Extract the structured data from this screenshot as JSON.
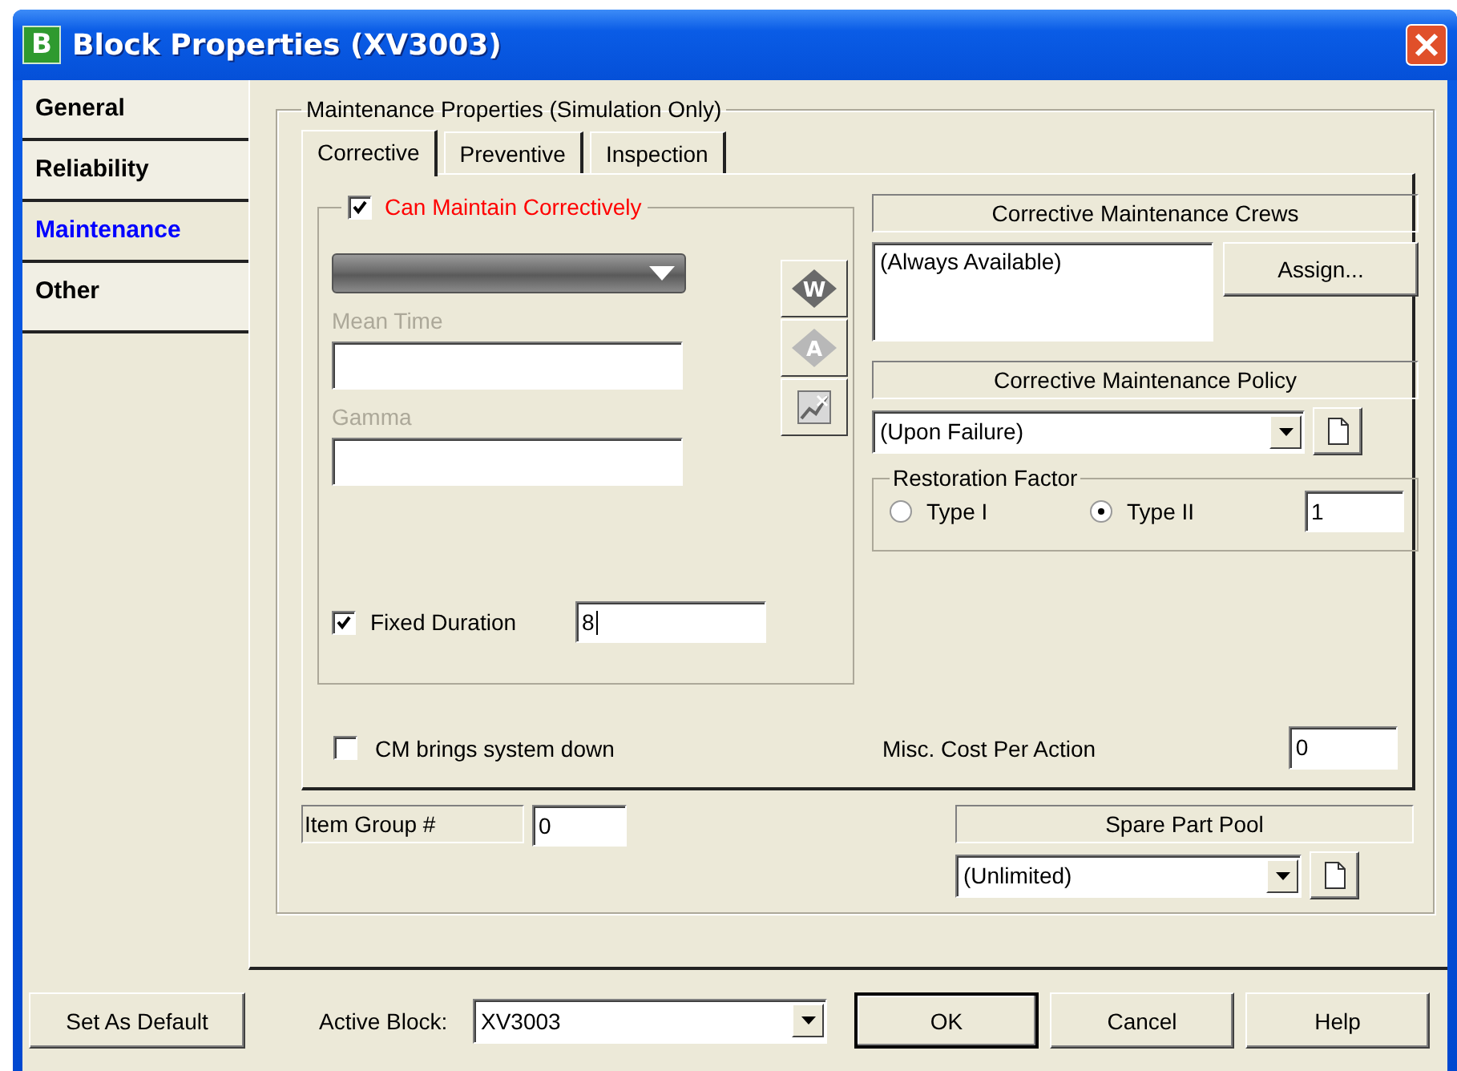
{
  "window": {
    "title": "Block Properties (XV3003)",
    "logo": "B"
  },
  "sidebar": {
    "items": [
      {
        "label": "General",
        "selected": false
      },
      {
        "label": "Reliability",
        "selected": false
      },
      {
        "label": "Maintenance",
        "selected": true
      },
      {
        "label": "Other",
        "selected": false
      }
    ]
  },
  "group_title": "Maintenance Properties (Simulation Only)",
  "tabs": [
    {
      "label": "Corrective",
      "selected": true
    },
    {
      "label": "Preventive",
      "selected": false
    },
    {
      "label": "Inspection",
      "selected": false
    }
  ],
  "corrective": {
    "can_maintain": {
      "label": "Can Maintain Correctively",
      "checked": true
    },
    "fields": [
      {
        "label": "Mean Time",
        "disabled": true
      },
      {
        "label": "Gamma",
        "disabled": true
      }
    ],
    "icon_buttons": [
      {
        "kind": "diamond",
        "label": "W",
        "disabled": false
      },
      {
        "kind": "diamond",
        "label": "A",
        "disabled": true
      },
      {
        "kind": "chart"
      }
    ],
    "fixed_duration": {
      "label": "Fixed Duration",
      "checked": true,
      "value": "8"
    },
    "crews": {
      "header": "Corrective Maintenance Crews",
      "items": [
        "(Always Available)"
      ],
      "button": "Assign..."
    },
    "policy": {
      "header": "Corrective Maintenance Policy",
      "value": "(Upon Failure)"
    },
    "restoration": {
      "title": "Restoration Factor",
      "options": [
        {
          "label": "Type I",
          "selected": false
        },
        {
          "label": "Type II",
          "selected": true
        }
      ],
      "value": "1"
    },
    "cm_down": {
      "label": "CM brings system down",
      "checked": false
    },
    "misc_cost": {
      "label": "Misc. Cost Per Action",
      "value": "0"
    }
  },
  "item_group": {
    "label": "Item Group #",
    "value": "0"
  },
  "spare_pool": {
    "header": "Spare Part Pool",
    "value": "(Unlimited)"
  },
  "footer": {
    "set_default": "Set As Default",
    "active_block": {
      "label": "Active Block:",
      "value": "XV3003"
    },
    "buttons": [
      {
        "label": "OK",
        "default": true
      },
      {
        "label": "Cancel",
        "default": false
      },
      {
        "label": "Help",
        "default": false
      }
    ]
  }
}
